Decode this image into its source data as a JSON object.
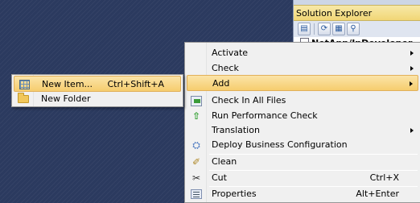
{
  "solution_explorer": {
    "title": "Solution Explorer",
    "toolbar_icons": [
      "properties-icon",
      "refresh-icon",
      "show-all-files-icon",
      "search-icon"
    ],
    "tree_root_label": "NetApp/InDeveloper"
  },
  "context_menu": {
    "items": [
      {
        "label": "Activate",
        "icon": "none",
        "has_submenu": true
      },
      {
        "label": "Check",
        "icon": "none",
        "has_submenu": true
      },
      {
        "label": "Add",
        "icon": "none",
        "has_submenu": true,
        "highlighted": true
      },
      {
        "label": "Check In All Files",
        "icon": "check-in-icon"
      },
      {
        "label": "Run Performance Check",
        "icon": "green-arrow-icon"
      },
      {
        "label": "Translation",
        "icon": "none",
        "has_submenu": true
      },
      {
        "label": "Deploy Business Configuration",
        "icon": "deploy-icon"
      },
      {
        "label": "Clean",
        "icon": "broom-icon"
      },
      {
        "label": "Cut",
        "icon": "scissors-icon",
        "shortcut": "Ctrl+X"
      },
      {
        "label": "Properties",
        "icon": "properties-icon",
        "shortcut": "Alt+Enter"
      }
    ]
  },
  "add_submenu": {
    "items": [
      {
        "label": "New Item...",
        "shortcut": "Ctrl+Shift+A",
        "icon": "new-item-icon"
      },
      {
        "label": "New Folder",
        "icon": "folder-icon"
      }
    ]
  },
  "colors": {
    "ide_background": "#2b3a5f",
    "highlight": "#f6cd6e",
    "solution_title_bar": "#f1d676",
    "menu_background": "#f0f0f0"
  }
}
